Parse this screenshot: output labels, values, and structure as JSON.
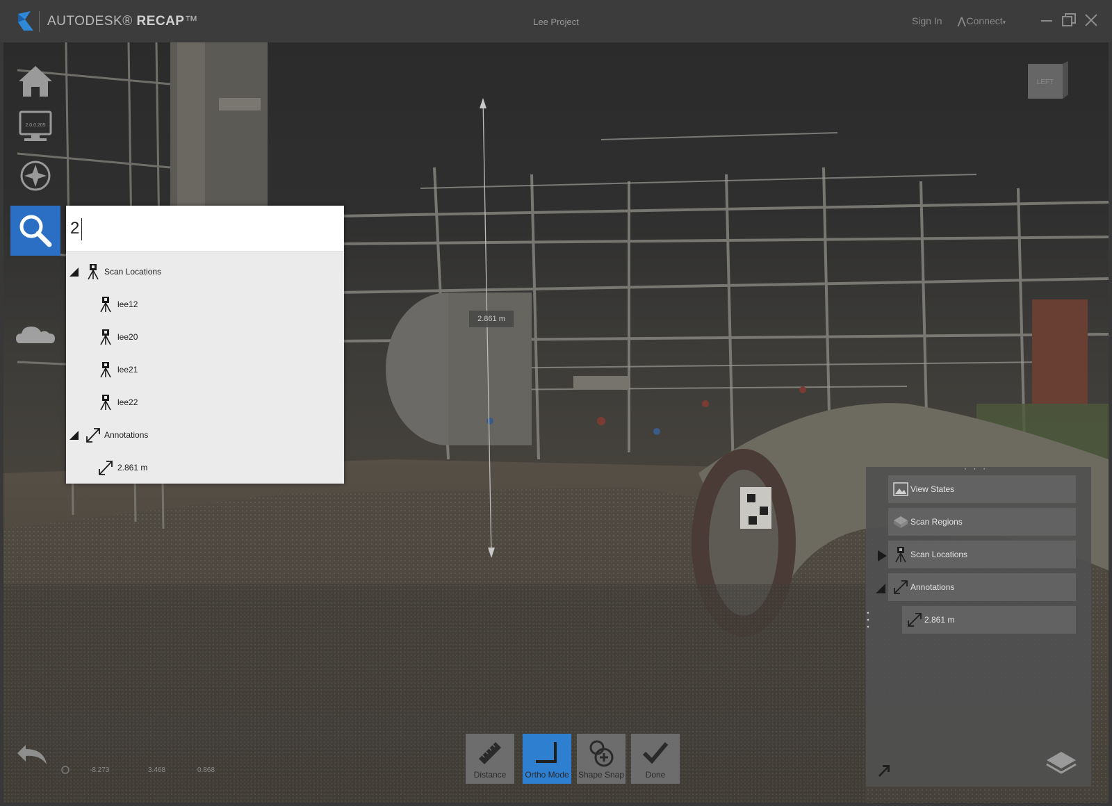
{
  "app": {
    "brand_name": "AUTODESK",
    "brand_product": "RECAP",
    "project_title": "Lee Project",
    "sign_in": "Sign In",
    "connect": "Connect"
  },
  "left_tools": {
    "display_caption": "2.0.0.205"
  },
  "search": {
    "query": "2",
    "groups": [
      {
        "label": "Scan Locations",
        "items": [
          "lee12",
          "lee20",
          "lee21",
          "lee22"
        ]
      },
      {
        "label": "Annotations",
        "items": [
          "2.861 m"
        ]
      }
    ]
  },
  "viewport": {
    "measurement_label": "2.861 m",
    "view_cube_face": "LEFT"
  },
  "right_panel": {
    "rows": [
      {
        "label": "View States",
        "icon": "image-icon"
      },
      {
        "label": "Scan Regions",
        "icon": "region-icon"
      },
      {
        "label": "Scan Locations",
        "icon": "tripod-icon",
        "expanded": false
      },
      {
        "label": "Annotations",
        "icon": "measure-icon",
        "expanded": true
      },
      {
        "label": "2.861 m",
        "icon": "measure-icon"
      }
    ]
  },
  "bottom_toolbar": {
    "distance": "Distance",
    "ortho": "Ortho Mode",
    "shape_snap": "Shape Snap",
    "done": "Done"
  },
  "status": {
    "x": "-8.273",
    "y": "3.468",
    "z": "0.868"
  },
  "colors": {
    "accent_blue": "#2b6fc4",
    "active_tool": "#2f7fd0",
    "titlebar": "#3c3c3c"
  }
}
